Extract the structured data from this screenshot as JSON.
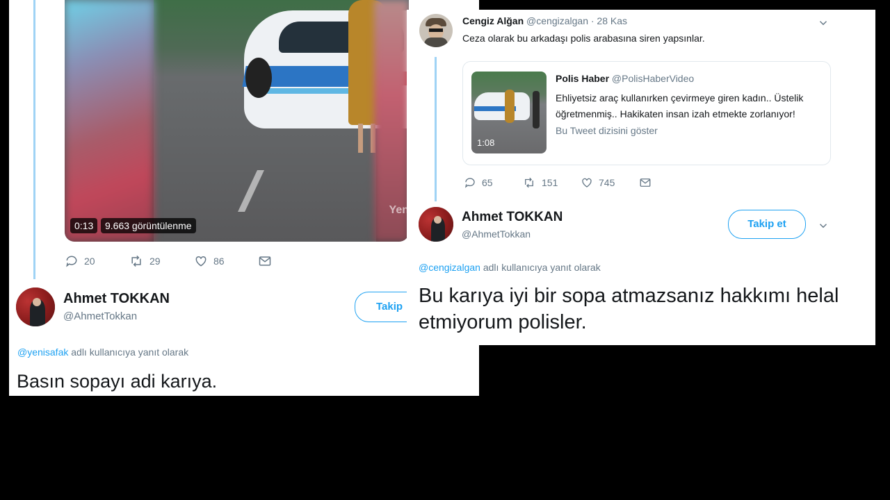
{
  "left_tweet": {
    "video": {
      "duration": "0:13",
      "views": "9.663 görüntülenme",
      "watermark": "Yen"
    },
    "actions": {
      "replies": "20",
      "retweets": "29",
      "likes": "86"
    },
    "reply": {
      "name": "Ahmet TOKKAN",
      "handle": "@AhmetTokkan",
      "follow_label": "Takip",
      "mention": "@yenisafak",
      "reply_suffix": "adlı kullanıcıya yanıt olarak",
      "text": "Basın sopayı adi karıya."
    }
  },
  "right_tweet": {
    "original": {
      "name": "Cengiz Alğan",
      "handle": "@cengizalgan",
      "date": "· 28 Kas",
      "text": "Ceza olarak bu arkadaşı polis arabasına siren yapsınlar.",
      "quote": {
        "name": "Polis Haber",
        "handle": "@PolisHaberVideo",
        "text_line1": "Ehliyetsiz araç kullanırken çevirmeye giren kadın.. Üstelik",
        "text_line2": "öğretmenmiş.. Hakikaten insan izah etmekte zorlanıyor!",
        "show_thread": "Bu Tweet dizisini göster",
        "thumb_duration": "1:08"
      },
      "actions": {
        "replies": "65",
        "retweets": "151",
        "likes": "745"
      }
    },
    "reply": {
      "name": "Ahmet TOKKAN",
      "handle": "@AhmetTokkan",
      "follow_label": "Takip et",
      "mention": "@cengizalgan",
      "reply_suffix": "adlı kullanıcıya yanıt olarak",
      "text_line1": "Bu karıya iyi bir sopa atmazsanız hakkımı helal",
      "text_line2": "etmiyorum polisler."
    }
  },
  "colors": {
    "accent": "#1da1f2",
    "muted": "#657786",
    "text": "#14171a",
    "thread": "#9fd3f5"
  },
  "icons": [
    "reply-icon",
    "retweet-icon",
    "like-icon",
    "dm-icon",
    "chevron-down-icon"
  ]
}
